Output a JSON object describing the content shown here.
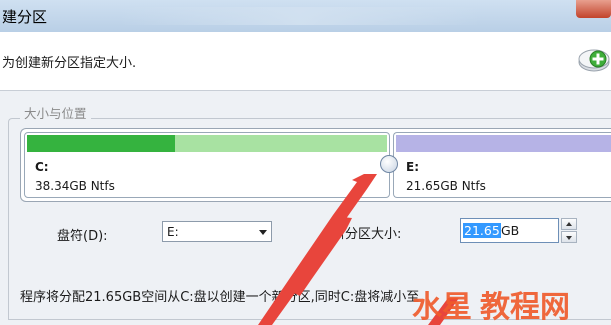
{
  "window": {
    "title": "建分区"
  },
  "header": {
    "instruction": "为创建新分区指定大小."
  },
  "group": {
    "legend": "大小与位置"
  },
  "partitions": [
    {
      "letter": "C:",
      "info": "38.34GB Ntfs",
      "used_fraction": 0.41,
      "color": "#35b33f"
    },
    {
      "letter": "E:",
      "info": "21.65GB Ntfs",
      "color": "#b6b3e6"
    }
  ],
  "drive_letter": {
    "label": "盘符(D):",
    "value": "E:"
  },
  "new_size": {
    "label": "新分区大小:",
    "value": "21.65",
    "unit": "GB"
  },
  "info": {
    "text": "程序将分配21.65GB空间从C:盘以创建一个新分区,同时C:盘将减小至"
  },
  "watermark": {
    "text": "教程网"
  },
  "colors": {
    "arrow": "#e8453c",
    "selection": "#3399ff"
  }
}
